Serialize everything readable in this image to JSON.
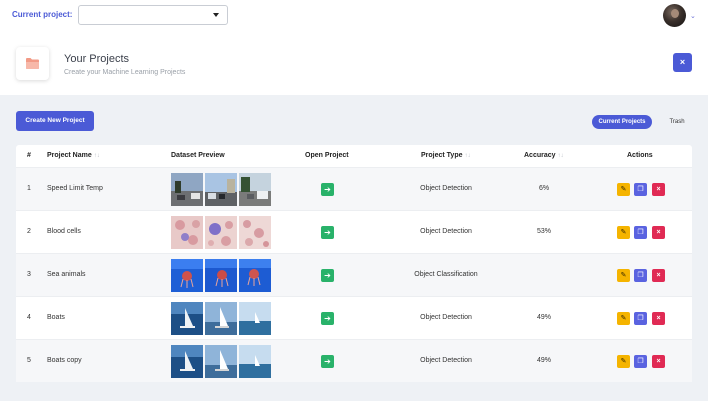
{
  "topbar": {
    "current_project_label": "Current project:",
    "current_project_value": "",
    "avatar_caret": "⌄"
  },
  "header": {
    "title": "Your Projects",
    "subtitle": "Create your Machine Learning Projects",
    "close_label": "×"
  },
  "toolbar": {
    "create_label": "Create New Project",
    "tab_current": "Current Projects",
    "tab_trash": "Trash"
  },
  "table": {
    "columns": {
      "num": "#",
      "name": "Project Name",
      "preview": "Dataset Preview",
      "open": "Open Project",
      "type": "Project Type",
      "accuracy": "Accuracy",
      "actions": "Actions"
    },
    "sort_glyph": "↑↓",
    "rows": [
      {
        "num": "1",
        "name": "Speed Limit Temp",
        "type": "Object Detection",
        "accuracy": "6%"
      },
      {
        "num": "2",
        "name": "Blood cells",
        "type": "Object Detection",
        "accuracy": "53%"
      },
      {
        "num": "3",
        "name": "Sea animals",
        "type": "Object Classification",
        "accuracy": ""
      },
      {
        "num": "4",
        "name": "Boats",
        "type": "Object Detection",
        "accuracy": "49%"
      },
      {
        "num": "5",
        "name": "Boats copy",
        "type": "Object Detection",
        "accuracy": "49%"
      }
    ],
    "open_glyph": "➔",
    "edit_glyph": "✎",
    "copy_glyph": "❐",
    "delete_glyph": "×"
  },
  "colors": {
    "accent": "#4b5ad6",
    "open_green": "#29b26a",
    "edit_yellow": "#f5b400",
    "copy_blue": "#5a63e0",
    "delete_red": "#e02a54"
  },
  "icons": {
    "folder": "folder-icon",
    "close": "close-icon",
    "dropdown": "chevron-down-icon",
    "open": "arrow-right-icon",
    "edit": "pencil-icon",
    "copy": "copy-icon",
    "delete": "delete-icon",
    "sort": "sort-icon"
  }
}
